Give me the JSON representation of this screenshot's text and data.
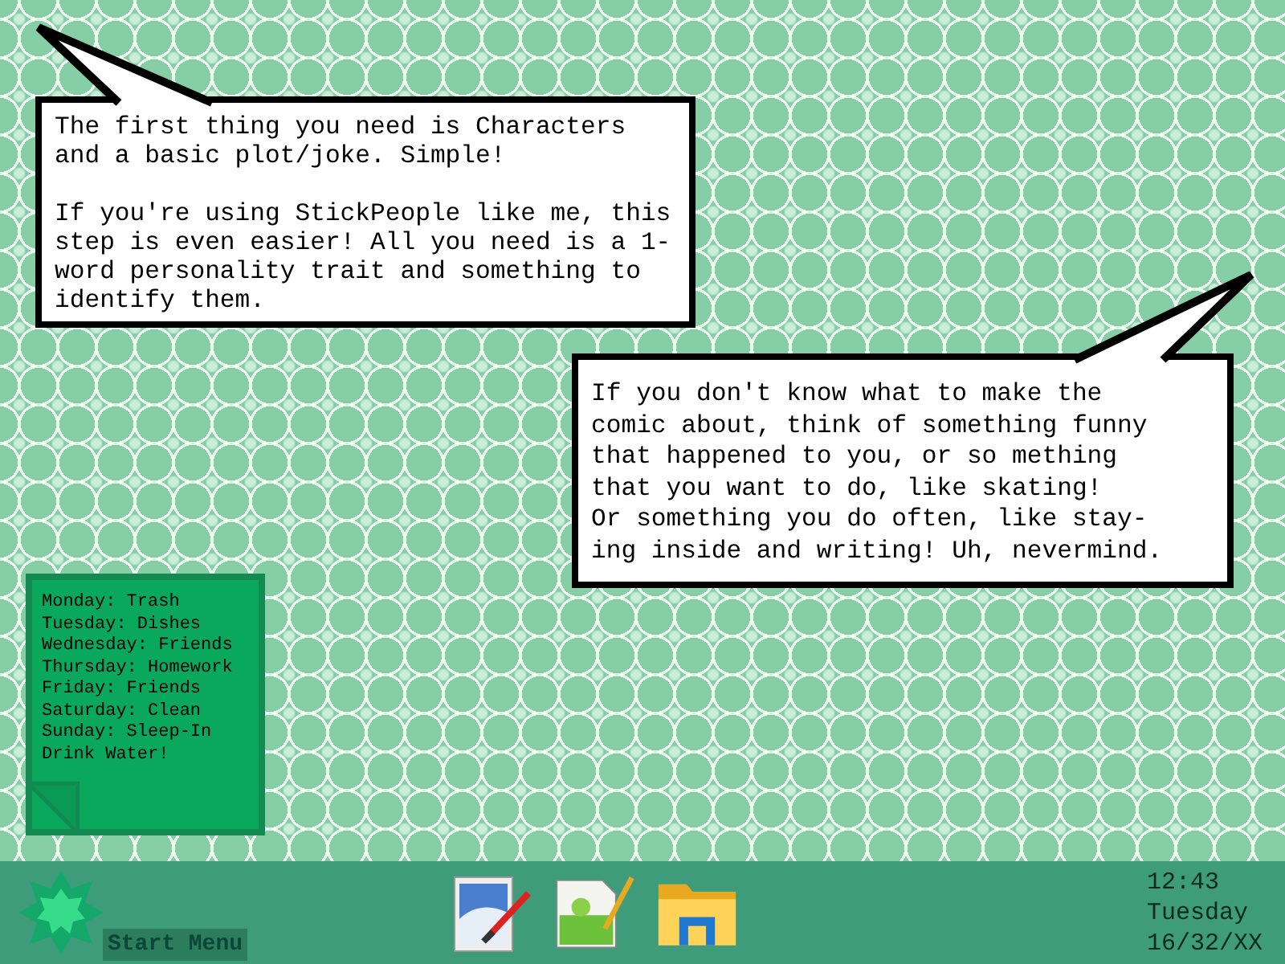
{
  "bubbles": [
    {
      "kind": "top-left",
      "text": "The first thing you need is Characters\nand a basic plot/joke. Simple!\n\nIf you're using StickPeople like me, this\nstep is even easier! All you need is a 1-\nword personality trait and something to\nidentify them."
    },
    {
      "kind": "top-right",
      "text": "If you don't know what to make the\ncomic about, think of something funny\nthat happened to you, or so mething\nthat you want to do, like skating!\nOr something you do often, like stay-\ning inside and writing! Uh, nevermind."
    }
  ],
  "sticky_note": {
    "lines": [
      "Monday: Trash",
      "Tuesday: Dishes",
      "Wednesday: Friends",
      "Thursday: Homework",
      "Friday: Friends",
      "Saturday: Clean",
      "Sunday: Sleep-In",
      "Drink Water!"
    ]
  },
  "taskbar": {
    "start_label": "Start Menu",
    "apps": [
      {
        "kind": "paint"
      },
      {
        "kind": "notepad"
      },
      {
        "kind": "folder"
      }
    ],
    "clock": {
      "time": "12:43",
      "day": "Tuesday",
      "date": "16/32/XX"
    }
  }
}
